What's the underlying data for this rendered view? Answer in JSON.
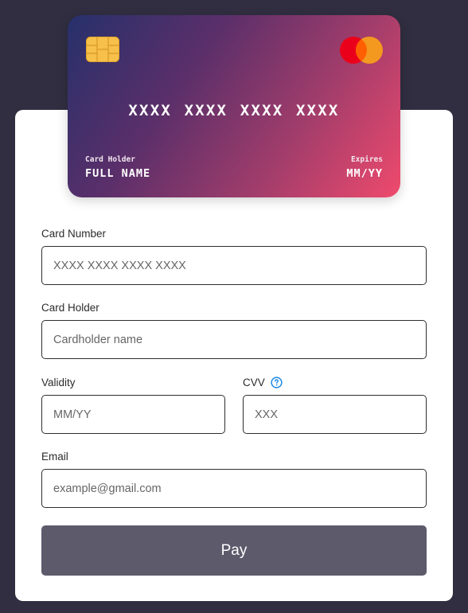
{
  "card_preview": {
    "number": "XXXX XXXX XXXX XXXX",
    "holder_caption": "Card Holder",
    "holder_value": "FULL NAME",
    "expires_caption": "Expires",
    "expires_value": "MM/YY",
    "chip_icon": "card-chip-icon",
    "brand_icon": "mastercard-logo-icon",
    "gradient_colors": [
      "#26306b",
      "#5b2f6a",
      "#a23d6b",
      "#ef4a6c"
    ]
  },
  "form": {
    "card_number": {
      "label": "Card Number",
      "placeholder": "XXXX XXXX XXXX XXXX",
      "value": ""
    },
    "card_holder": {
      "label": "Card Holder",
      "placeholder": "Cardholder name",
      "value": ""
    },
    "validity": {
      "label": "Validity",
      "placeholder": "MM/YY",
      "value": ""
    },
    "cvv": {
      "label": "CVV",
      "placeholder": "XXX",
      "value": "",
      "help_icon": "question-circle-icon"
    },
    "email": {
      "label": "Email",
      "placeholder": "example@gmail.com",
      "value": ""
    },
    "submit_label": "Pay"
  },
  "colors": {
    "background": "#302e40",
    "panel": "#ffffff",
    "button": "#5c5a6b",
    "help_icon": "#1e88e5",
    "mastercard_red": "#eb001b",
    "mastercard_orange": "#f79e1b"
  }
}
